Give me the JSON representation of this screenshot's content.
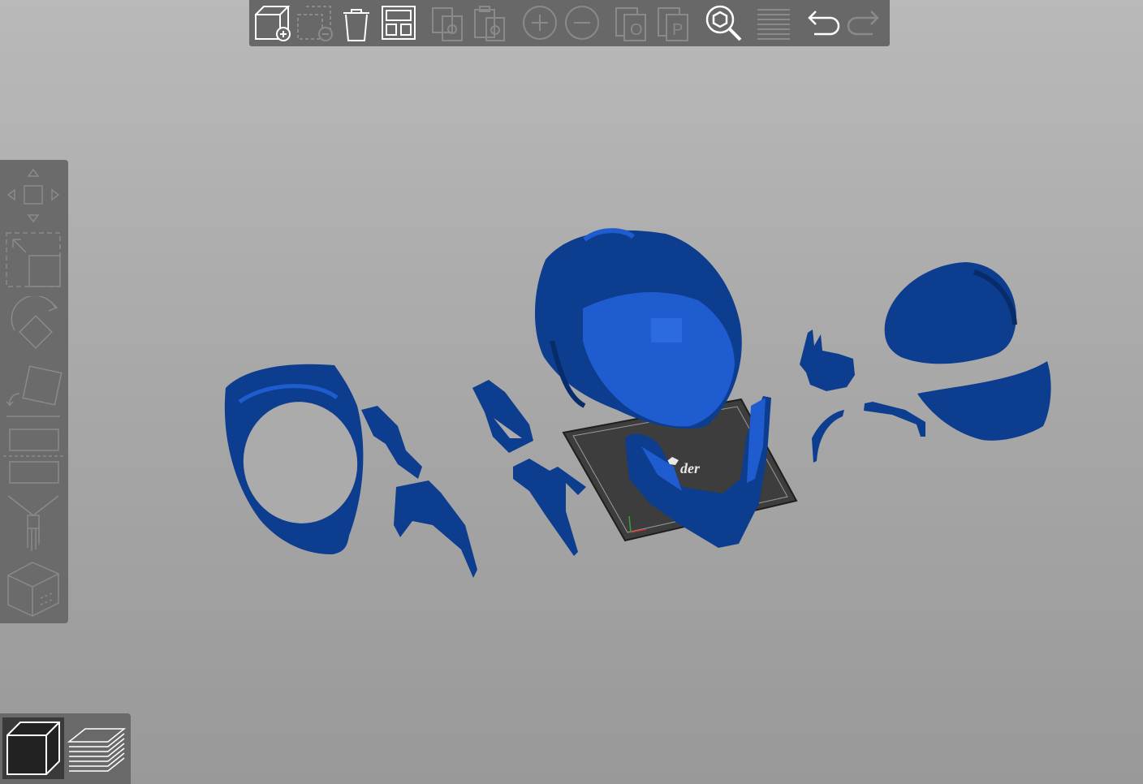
{
  "app": {
    "colors": {
      "model": "#0c3d8f",
      "model_highlight": "#1f5ccf",
      "icon_enabled": "#ffffff",
      "icon_disabled": "#8a8a8a",
      "panel": "#686868",
      "plate": "#3a3a3a"
    }
  },
  "toolbar": {
    "buttons": [
      {
        "icon": "add-model-icon",
        "enabled": true
      },
      {
        "icon": "remove-model-icon",
        "enabled": false
      },
      {
        "icon": "delete-icon",
        "enabled": true
      },
      {
        "icon": "auto-arrange-icon",
        "enabled": true
      },
      {
        "icon": "copy-icon",
        "enabled": false
      },
      {
        "icon": "paste-icon",
        "enabled": false
      },
      {
        "icon": "zoom-in-icon",
        "enabled": false
      },
      {
        "icon": "zoom-out-icon",
        "enabled": false
      },
      {
        "icon": "cut-o-icon",
        "enabled": false,
        "letter": "O"
      },
      {
        "icon": "cut-p-icon",
        "enabled": false,
        "letter": "P"
      },
      {
        "icon": "search-model-icon",
        "enabled": true
      },
      {
        "icon": "layers-icon",
        "enabled": true
      },
      {
        "icon": "undo-icon",
        "enabled": true
      },
      {
        "icon": "redo-icon",
        "enabled": false
      }
    ]
  },
  "sidebar": {
    "tools": [
      "move-icon",
      "scale-icon",
      "rotate-icon",
      "lay-flat-icon",
      "split-icon",
      "support-brush-icon",
      "view-cube-icon"
    ]
  },
  "view_modes": [
    {
      "icon": "solid-view-icon",
      "active": true
    },
    {
      "icon": "layer-view-icon",
      "active": false
    }
  ],
  "build_plate": {
    "logo_text": "der"
  }
}
